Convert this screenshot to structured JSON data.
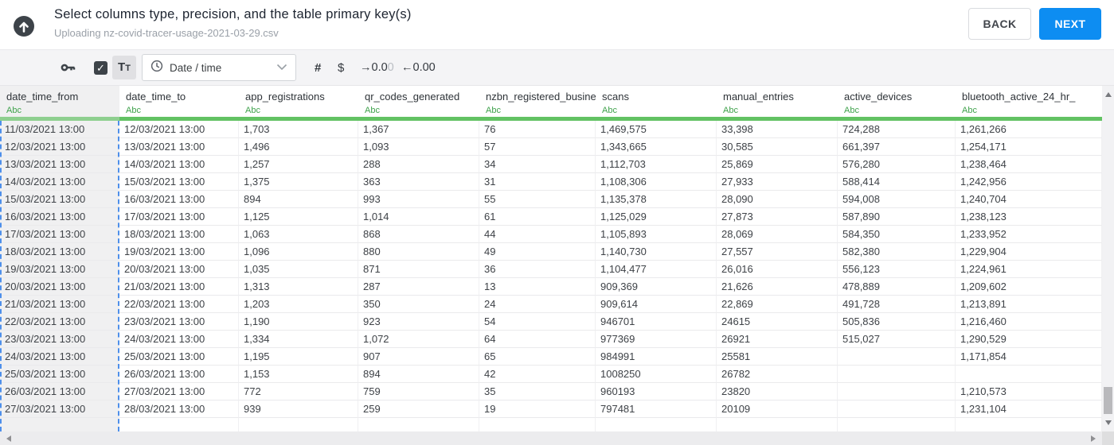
{
  "header": {
    "title": "Select columns type, precision, and the table primary key(s)",
    "subtitle": "Uploading nz-covid-tracer-usage-2021-03-29.csv",
    "back_label": "BACK",
    "next_label": "NEXT"
  },
  "toolbar": {
    "checkbox_checked": true,
    "check_glyph": "✓",
    "text_format_button": {
      "first": "T",
      "second": "T"
    },
    "type_dropdown_value": "Date / time",
    "hash_label": "#",
    "dollar_label": "$",
    "precision_decrease": {
      "main": "→0.0",
      "faded": "0"
    },
    "precision_increase": {
      "main": "←0.00",
      "faded": ""
    }
  },
  "colors": {
    "accent_blue": "#0d8df2",
    "type_green": "#3da14a",
    "underline_green": "#62c263",
    "underline_green_selected": "#8ecf8f",
    "selection_dash_blue": "#4e8fea",
    "dark_icon": "#3d4349"
  },
  "table": {
    "columns": [
      {
        "name": "date_time_from",
        "type_label": "Abc",
        "selected": true
      },
      {
        "name": "date_time_to",
        "type_label": "Abc",
        "selected": false
      },
      {
        "name": "app_registrations",
        "type_label": "Abc",
        "selected": false
      },
      {
        "name": "qr_codes_generated",
        "type_label": "Abc",
        "selected": false
      },
      {
        "name": "nzbn_registered_busine",
        "type_label": "Abc",
        "selected": false
      },
      {
        "name": "scans",
        "type_label": "Abc",
        "selected": false
      },
      {
        "name": "manual_entries",
        "type_label": "Abc",
        "selected": false
      },
      {
        "name": "active_devices",
        "type_label": "Abc",
        "selected": false
      },
      {
        "name": "bluetooth_active_24_hr_",
        "type_label": "Abc",
        "selected": false
      }
    ],
    "rows": [
      [
        "11/03/2021 13:00",
        "12/03/2021 13:00",
        "1,703",
        "1,367",
        "76",
        "1,469,575",
        "33,398",
        "724,288",
        "1,261,266"
      ],
      [
        "12/03/2021 13:00",
        "13/03/2021 13:00",
        "1,496",
        "1,093",
        "57",
        "1,343,665",
        "30,585",
        "661,397",
        "1,254,171"
      ],
      [
        "13/03/2021 13:00",
        "14/03/2021 13:00",
        "1,257",
        "288",
        "34",
        "1,112,703",
        "25,869",
        "576,280",
        "1,238,464"
      ],
      [
        "14/03/2021 13:00",
        "15/03/2021 13:00",
        "1,375",
        "363",
        "31",
        "1,108,306",
        "27,933",
        "588,414",
        "1,242,956"
      ],
      [
        "15/03/2021 13:00",
        "16/03/2021 13:00",
        "894",
        "993",
        "55",
        "1,135,378",
        "28,090",
        "594,008",
        "1,240,704"
      ],
      [
        "16/03/2021 13:00",
        "17/03/2021 13:00",
        "1,125",
        "1,014",
        "61",
        "1,125,029",
        "27,873",
        "587,890",
        "1,238,123"
      ],
      [
        "17/03/2021 13:00",
        "18/03/2021 13:00",
        "1,063",
        "868",
        "44",
        "1,105,893",
        "28,069",
        "584,350",
        "1,233,952"
      ],
      [
        "18/03/2021 13:00",
        "19/03/2021 13:00",
        "1,096",
        "880",
        "49",
        "1,140,730",
        "27,557",
        "582,380",
        "1,229,904"
      ],
      [
        "19/03/2021 13:00",
        "20/03/2021 13:00",
        "1,035",
        "871",
        "36",
        "1,104,477",
        "26,016",
        "556,123",
        "1,224,961"
      ],
      [
        "20/03/2021 13:00",
        "21/03/2021 13:00",
        "1,313",
        "287",
        "13",
        "909,369",
        "21,626",
        "478,889",
        "1,209,602"
      ],
      [
        "21/03/2021 13:00",
        "22/03/2021 13:00",
        "1,203",
        "350",
        "24",
        "909,614",
        "22,869",
        "491,728",
        "1,213,891"
      ],
      [
        "22/03/2021 13:00",
        "23/03/2021 13:00",
        "1,190",
        "923",
        "54",
        "946701",
        "24615",
        "505,836",
        "1,216,460"
      ],
      [
        "23/03/2021 13:00",
        "24/03/2021 13:00",
        "1,334",
        "1,072",
        "64",
        "977369",
        "26921",
        "515,027",
        "1,290,529"
      ],
      [
        "24/03/2021 13:00",
        "25/03/2021 13:00",
        "1,195",
        "907",
        "65",
        "984991",
        "25581",
        "",
        "1,171,854"
      ],
      [
        "25/03/2021 13:00",
        "26/03/2021 13:00",
        "1,153",
        "894",
        "42",
        "1008250",
        "26782",
        "",
        ""
      ],
      [
        "26/03/2021 13:00",
        "27/03/2021 13:00",
        "772",
        "759",
        "35",
        "960193",
        "23820",
        "",
        "1,210,573"
      ],
      [
        "27/03/2021 13:00",
        "28/03/2021 13:00",
        "939",
        "259",
        "19",
        "797481",
        "20109",
        "",
        "1,231,104"
      ],
      [
        "",
        "",
        "",
        "",
        "",
        "",
        "",
        "",
        ""
      ]
    ]
  }
}
